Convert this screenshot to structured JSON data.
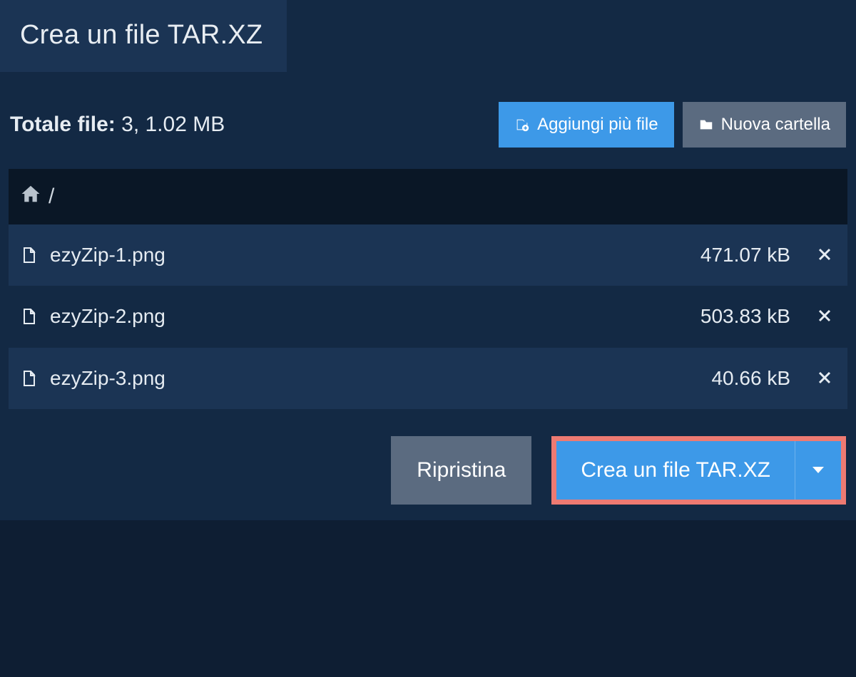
{
  "tab": {
    "title": "Crea un file TAR.XZ"
  },
  "summary": {
    "label": "Totale file:",
    "value": "3, 1.02 MB"
  },
  "actions": {
    "add_files": "Aggiungi più file",
    "new_folder": "Nuova cartella"
  },
  "breadcrumb": {
    "path": "/"
  },
  "files": [
    {
      "name": "ezyZip-1.png",
      "size": "471.07 kB"
    },
    {
      "name": "ezyZip-2.png",
      "size": "503.83 kB"
    },
    {
      "name": "ezyZip-3.png",
      "size": "40.66 kB"
    }
  ],
  "footer": {
    "reset": "Ripristina",
    "create": "Crea un file TAR.XZ"
  },
  "colors": {
    "accent": "#3d99e8",
    "highlight": "#ee7a72",
    "bg_dark": "#0e1e33",
    "panel": "#132944"
  }
}
